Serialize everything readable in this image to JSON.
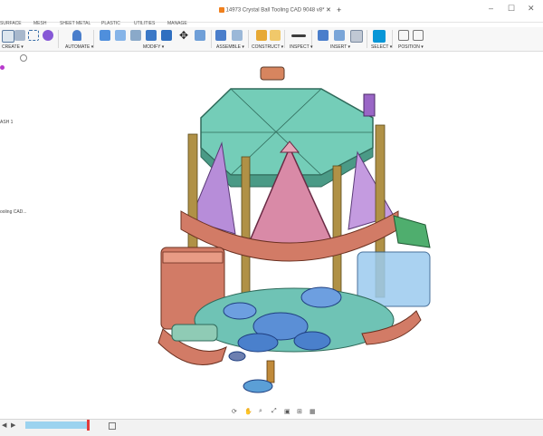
{
  "window": {
    "title": "14973 Crystal Ball Tooling CAD 9048 v8*",
    "close_tab": "✕",
    "add_tab": "+",
    "minimize": "–",
    "maximize": "☐",
    "close_window": "✕"
  },
  "workspace_tabs": [
    "SURFACE",
    "MESH",
    "SHEET METAL",
    "PLASTIC",
    "UTILITIES",
    "MANAGE"
  ],
  "toolbar_groups": [
    "CREATE ▾",
    "AUTOMATE ▾",
    "MODIFY ▾",
    "ASSEMBLE ▾",
    "CONSTRUCT ▾",
    "INSPECT ▾",
    "INSERT ▾",
    "SELECT ▾",
    "POSITION ▾"
  ],
  "browser_items": [
    "ASH 1",
    "ooling CAD..."
  ],
  "colors": {
    "accent": "#0696d7",
    "teal_plate": "#6ac9b4",
    "salmon": "#d27b66",
    "purple": "#b88bd6",
    "pink": "#d98aa7",
    "blue_gear": "#5b8fd6",
    "spring": "#9c7a3a",
    "green": "#3e9c5a"
  },
  "icons": [
    "orbit-icon",
    "pan-icon",
    "zoom-icon",
    "fit-icon",
    "display-icon",
    "grid-icon",
    "viewport-icon"
  ]
}
